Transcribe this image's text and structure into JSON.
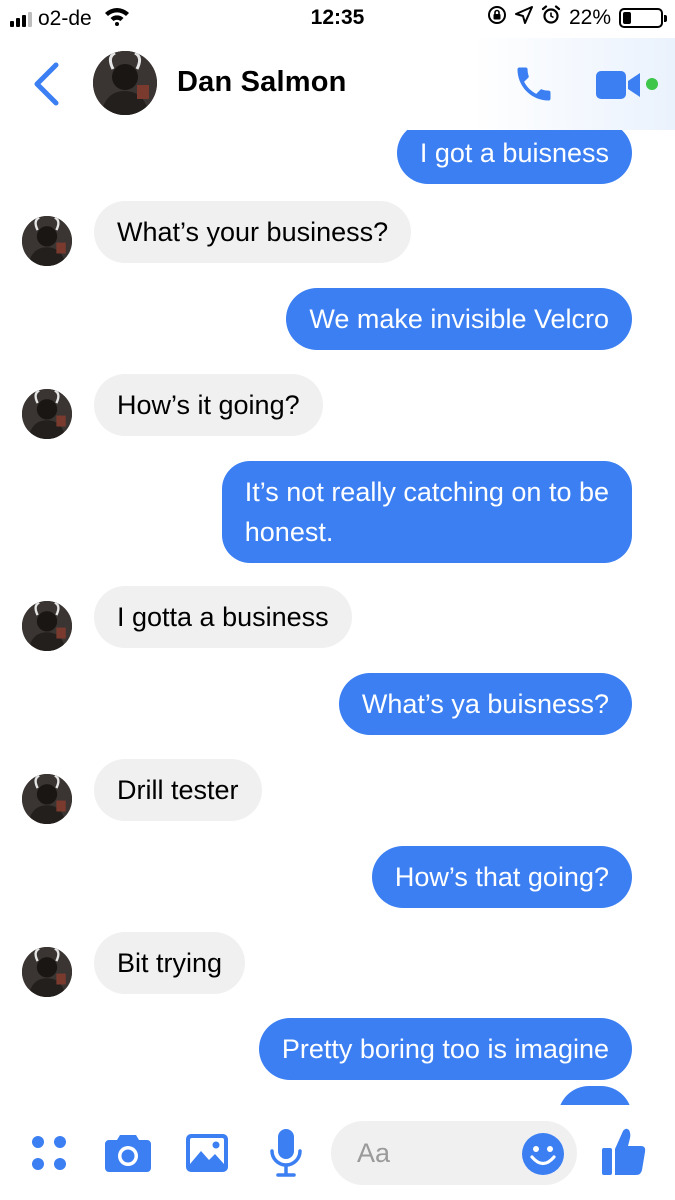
{
  "status_bar": {
    "carrier": "o2-de",
    "time": "12:35",
    "battery": "22%",
    "battery_level": 0.22
  },
  "header": {
    "contact_name": "Dan Salmon",
    "online": true
  },
  "messages": [
    {
      "direction": "outgoing",
      "text": "I got a buisness"
    },
    {
      "direction": "incoming",
      "text": "What’s your business?"
    },
    {
      "direction": "outgoing",
      "text": "We make invisible Velcro"
    },
    {
      "direction": "incoming",
      "text": "How’s it going?"
    },
    {
      "direction": "outgoing",
      "lines": [
        "It’s not really catching on to be",
        "honest."
      ]
    },
    {
      "direction": "incoming",
      "text": "I gotta a business"
    },
    {
      "direction": "outgoing",
      "text": "What’s ya buisness?"
    },
    {
      "direction": "incoming",
      "text": "Drill tester"
    },
    {
      "direction": "outgoing",
      "text": "How’s that going?"
    },
    {
      "direction": "incoming",
      "text": "Bit trying"
    },
    {
      "direction": "outgoing",
      "text": "Pretty boring too is imagine"
    }
  ],
  "composer": {
    "placeholder": "Aa"
  },
  "colors": {
    "accent": "#3b7ff3",
    "outgoing_bubble": "#3b7ff3",
    "incoming_bubble": "#f1f0f0",
    "online": "#3ec64b"
  },
  "icons": {
    "toolbar": [
      "apps-grid-icon",
      "camera-icon",
      "gallery-icon",
      "microphone-icon",
      "emoji-icon",
      "thumbs-up-icon"
    ],
    "header": [
      "back-chevron-icon",
      "phone-icon",
      "video-camera-icon"
    ]
  }
}
